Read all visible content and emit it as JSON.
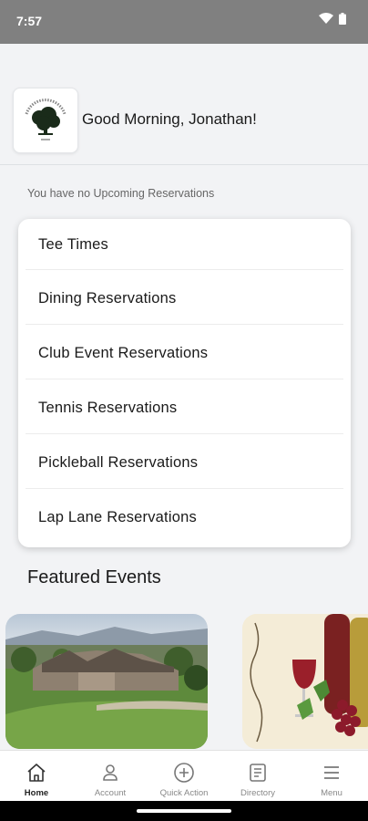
{
  "status_bar": {
    "time": "7:57"
  },
  "header": {
    "greeting": "Good Morning, Jonathan!",
    "logo_icon": "club-logo-tree"
  },
  "reservations": {
    "empty_message": "You have no Upcoming Reservations",
    "items": [
      {
        "label": "Tee Times"
      },
      {
        "label": "Dining Reservations"
      },
      {
        "label": "Club Event Reservations"
      },
      {
        "label": "Tennis Reservations"
      },
      {
        "label": "Pickleball Reservations"
      },
      {
        "label": "Lap Lane Reservations"
      }
    ]
  },
  "featured": {
    "title": "Featured Events"
  },
  "bottom_nav": {
    "items": [
      {
        "label": "Home",
        "icon": "home-icon",
        "active": true
      },
      {
        "label": "Account",
        "icon": "user-icon",
        "active": false
      },
      {
        "label": "Quick Action",
        "icon": "plus-circle-icon",
        "active": false
      },
      {
        "label": "Directory",
        "icon": "directory-icon",
        "active": false
      },
      {
        "label": "Menu",
        "icon": "menu-icon",
        "active": false
      }
    ]
  }
}
